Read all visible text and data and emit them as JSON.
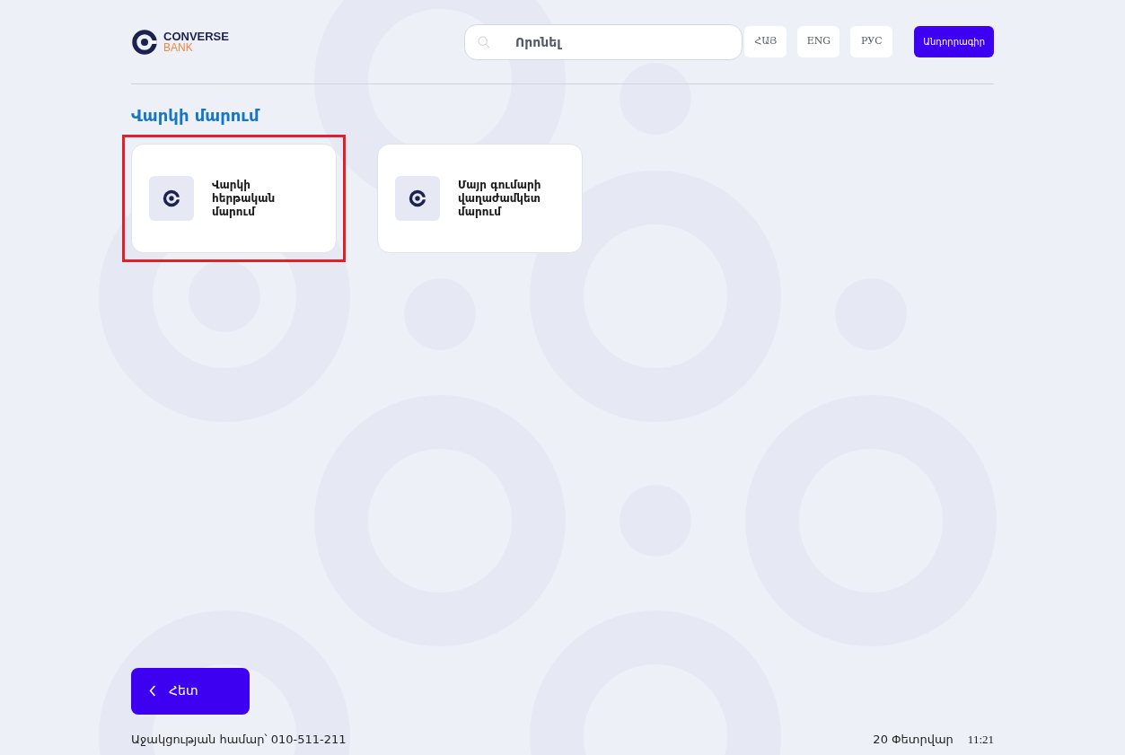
{
  "logo": {
    "name": "CONVERSE",
    "sub": "BANK"
  },
  "search": {
    "placeholder": "Որոնել"
  },
  "languages": [
    {
      "label": "ՀԱՅ",
      "selected": false
    },
    {
      "label": "ENG",
      "selected": false
    },
    {
      "label": "РУС",
      "selected": false
    }
  ],
  "header_button": "Անդորրագիր",
  "section_title": "Վարկի մարում",
  "cards": [
    {
      "label": "Վարկի հերթական մարում",
      "selected": true
    },
    {
      "label": "Մայր գումարի վաղաժամկետ մարում",
      "selected": false
    }
  ],
  "back_button": "Հետ",
  "footer": {
    "support": "Աջակցության համար՝ 010-511-211",
    "date": "20 Փետրվար",
    "time": "11:21"
  }
}
